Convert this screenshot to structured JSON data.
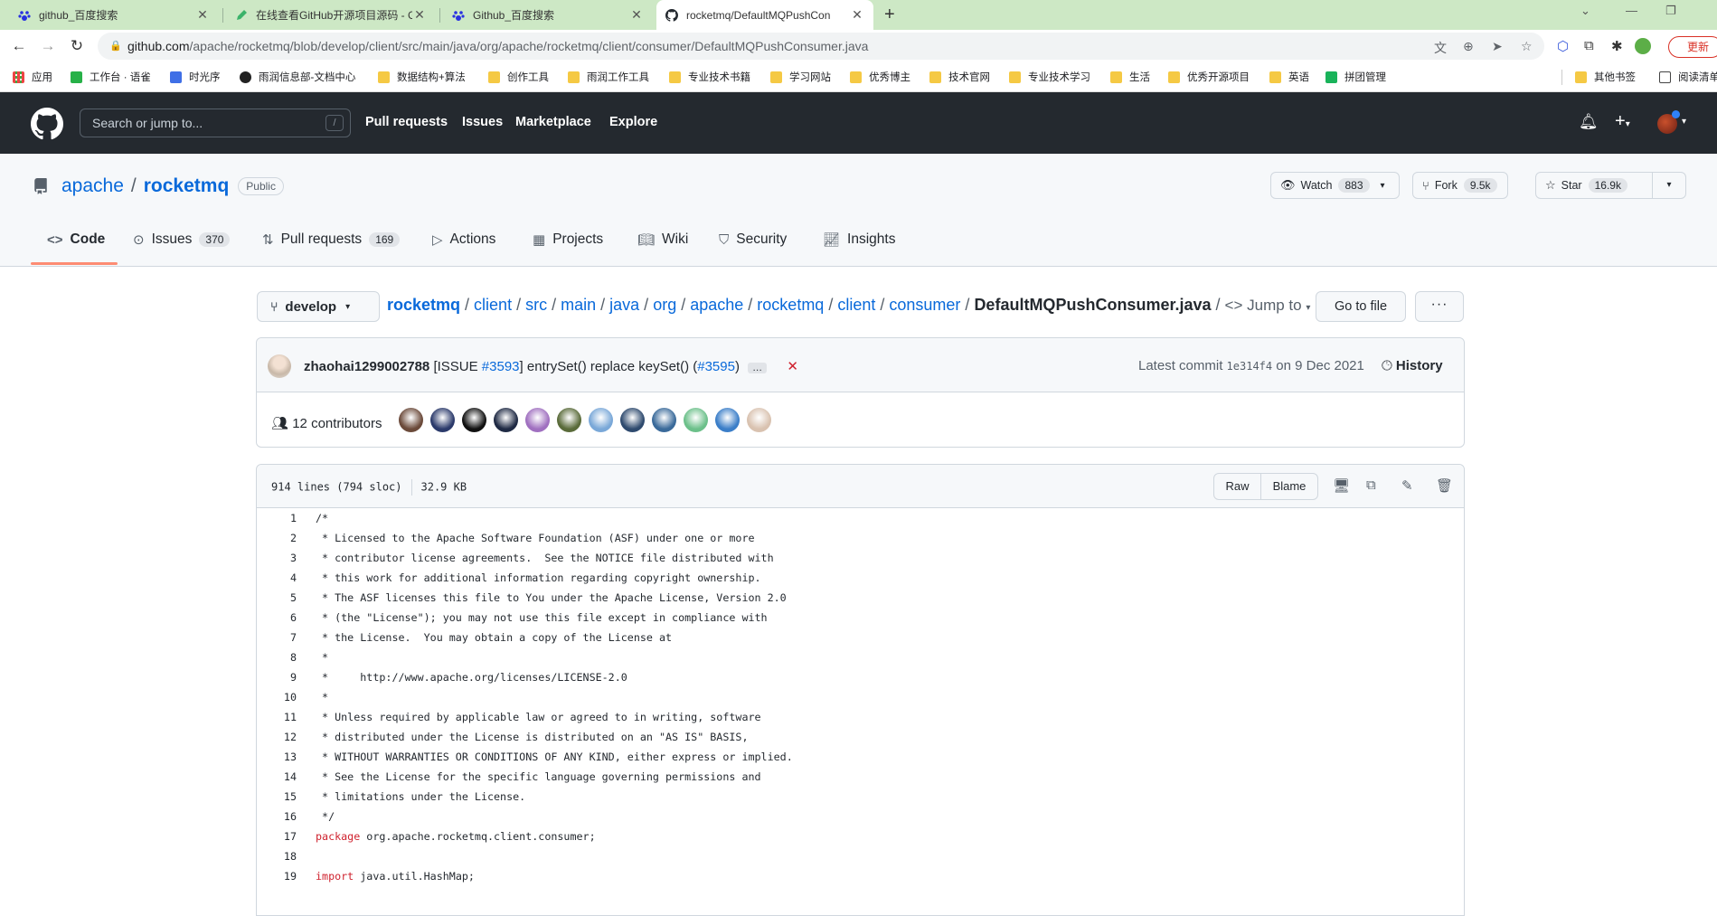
{
  "browser": {
    "tabs": [
      {
        "title": "github_百度搜索",
        "icon": "baidu-icon"
      },
      {
        "title": "在线查看GitHub开源项目源码 - G",
        "icon": "pencil-icon"
      },
      {
        "title": "Github_百度搜索",
        "icon": "baidu-icon"
      },
      {
        "title": "rocketmq/DefaultMQPushCon",
        "icon": "github-icon"
      }
    ],
    "new_tab": "+",
    "address": {
      "domain": "github.com",
      "path": "/apache/rocketmq/blob/develop/client/src/main/java/org/apache/rocketmq/client/consumer/DefaultMQPushConsumer.java"
    },
    "update_label": "更新",
    "bookmarks": [
      {
        "label": "应用",
        "icon": "apps-grid-icon"
      },
      {
        "label": "工作台 · 语雀",
        "icon": "yuque-icon"
      },
      {
        "label": "时光序",
        "icon": "shiguangxu-icon"
      },
      {
        "label": "雨润信息部-文档中心",
        "icon": "globe-icon"
      },
      {
        "label": "数据结构+算法",
        "icon": "folder-icon"
      },
      {
        "label": "创作工具",
        "icon": "folder-icon"
      },
      {
        "label": "雨润工作工具",
        "icon": "folder-icon"
      },
      {
        "label": "专业技术书籍",
        "icon": "folder-icon"
      },
      {
        "label": "学习网站",
        "icon": "folder-icon"
      },
      {
        "label": "优秀博主",
        "icon": "folder-icon"
      },
      {
        "label": "技术官网",
        "icon": "folder-icon"
      },
      {
        "label": "专业技术学习",
        "icon": "folder-icon"
      },
      {
        "label": "生活",
        "icon": "folder-icon"
      },
      {
        "label": "优秀开源项目",
        "icon": "folder-icon"
      },
      {
        "label": "英语",
        "icon": "folder-icon"
      },
      {
        "label": "拼团管理",
        "icon": "play-icon"
      },
      {
        "label": "其他书签",
        "icon": "folder-icon"
      },
      {
        "label": "阅读清单",
        "icon": "reading-list-icon"
      }
    ]
  },
  "github": {
    "search_placeholder": "Search or jump to...",
    "search_key": "/",
    "nav": [
      "Pull requests",
      "Issues",
      "Marketplace",
      "Explore"
    ]
  },
  "repo": {
    "owner": "apache",
    "name": "rocketmq",
    "visibility": "Public",
    "watch": {
      "label": "Watch",
      "count": "883"
    },
    "fork": {
      "label": "Fork",
      "count": "9.5k"
    },
    "star": {
      "label": "Star",
      "count": "16.9k"
    },
    "tabs": [
      {
        "label": "Code",
        "count": "",
        "icon": "code-icon"
      },
      {
        "label": "Issues",
        "count": "370",
        "icon": "issue-icon"
      },
      {
        "label": "Pull requests",
        "count": "169",
        "icon": "pull-request-icon"
      },
      {
        "label": "Actions",
        "count": "",
        "icon": "play-icon"
      },
      {
        "label": "Projects",
        "count": "",
        "icon": "table-icon"
      },
      {
        "label": "Wiki",
        "count": "",
        "icon": "book-icon"
      },
      {
        "label": "Security",
        "count": "",
        "icon": "shield-icon"
      },
      {
        "label": "Insights",
        "count": "",
        "icon": "graph-icon"
      }
    ]
  },
  "file_nav": {
    "branch": "develop",
    "crumbs": [
      "rocketmq",
      "client",
      "src",
      "main",
      "java",
      "org",
      "apache",
      "rocketmq",
      "client",
      "consumer"
    ],
    "file": "DefaultMQPushConsumer.java",
    "jump_to": "Jump to",
    "go_to_file": "Go to file",
    "more": "···"
  },
  "commit": {
    "author": "zhaohai1299002788",
    "msg_pre": "[ISSUE ",
    "issue_link": "#3593",
    "msg_mid": "] entrySet() replace keySet() (",
    "pr_link": "#3595",
    "msg_post": ")",
    "ellipsis": "…",
    "status": "✕",
    "latest_label": "Latest commit",
    "sha": "1e314f4",
    "date": "on 9 Dec 2021",
    "history": "History",
    "contributors": "12 contributors",
    "contributor_colors": [
      "#6b4a3a",
      "#2b3a6b",
      "#111111",
      "#1f2a44",
      "#a070c0",
      "#5a6b3a",
      "#7aa8d8",
      "#2e4a6e",
      "#3a6a9a",
      "#6cc08a",
      "#3b7ec8",
      "#d9c2b0"
    ]
  },
  "file": {
    "lines_info": "914 lines (794 sloc)",
    "size": "32.9 KB",
    "raw": "Raw",
    "blame": "Blame",
    "code": [
      {
        "n": "1",
        "t": "/*"
      },
      {
        "n": "2",
        "t": " * Licensed to the Apache Software Foundation (ASF) under one or more"
      },
      {
        "n": "3",
        "t": " * contributor license agreements.  See the NOTICE file distributed with"
      },
      {
        "n": "4",
        "t": " * this work for additional information regarding copyright ownership."
      },
      {
        "n": "5",
        "t": " * The ASF licenses this file to You under the Apache License, Version 2.0"
      },
      {
        "n": "6",
        "t": " * (the \"License\"); you may not use this file except in compliance with"
      },
      {
        "n": "7",
        "t": " * the License.  You may obtain a copy of the License at"
      },
      {
        "n": "8",
        "t": " *"
      },
      {
        "n": "9",
        "t": " *     http://www.apache.org/licenses/LICENSE-2.0"
      },
      {
        "n": "10",
        "t": " *"
      },
      {
        "n": "11",
        "t": " * Unless required by applicable law or agreed to in writing, software"
      },
      {
        "n": "12",
        "t": " * distributed under the License is distributed on an \"AS IS\" BASIS,"
      },
      {
        "n": "13",
        "t": " * WITHOUT WARRANTIES OR CONDITIONS OF ANY KIND, either express or implied."
      },
      {
        "n": "14",
        "t": " * See the License for the specific language governing permissions and"
      },
      {
        "n": "15",
        "t": " * limitations under the License."
      },
      {
        "n": "16",
        "t": " */"
      },
      {
        "n": "17",
        "kw": "package",
        "t": " org.apache.rocketmq.client.consumer;"
      },
      {
        "n": "18",
        "t": ""
      },
      {
        "n": "19",
        "kw": "import",
        "t": " java.util.HashMap;"
      }
    ]
  }
}
